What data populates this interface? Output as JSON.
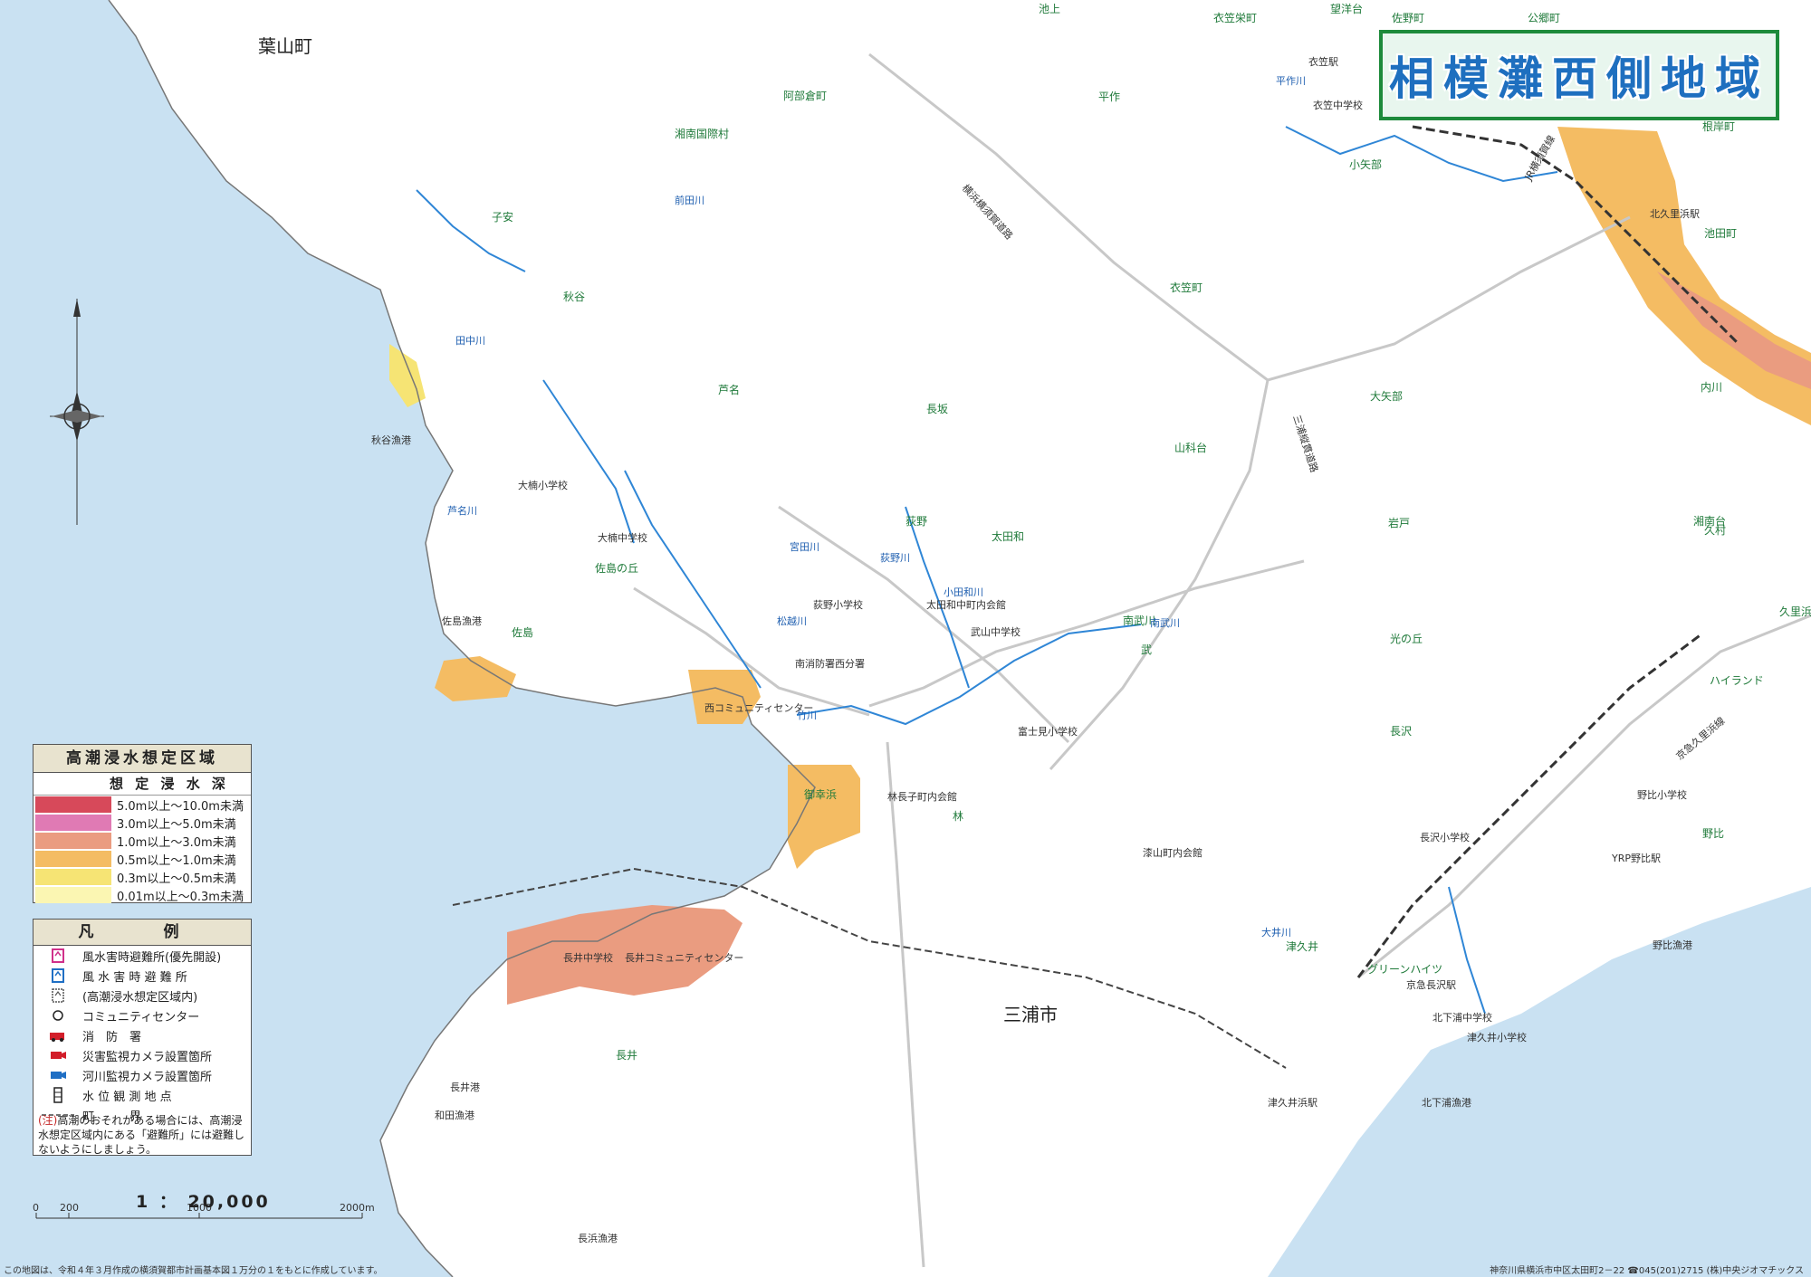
{
  "title": "相模灘西側地域",
  "scale": "1 ： 20,000",
  "scalebar_ticks": [
    "0",
    "200",
    "1000",
    "2000m"
  ],
  "municipalities": [
    "葉山町",
    "三浦市"
  ],
  "stations": [
    "衣笠駅",
    "北久里浜駅",
    "京急長沢駅",
    "津久井浜駅",
    "YRP野比駅"
  ],
  "district_labels": [
    "衣笠栄町",
    "阿部倉町",
    "平作",
    "池上",
    "望洋台",
    "佐野町",
    "公郷町",
    "湘南国際村",
    "子安",
    "秋谷",
    "小矢部",
    "衣笠町",
    "芦名",
    "長坂",
    "大矢部",
    "山科台",
    "佐島の丘",
    "太田和",
    "荻野",
    "佐島",
    "御幸浜",
    "林",
    "武",
    "南武川",
    "光の丘",
    "長沢",
    "野比",
    "津久井",
    "長井",
    "グリーンハイツ",
    "岩戸",
    "久村",
    "ハイランド",
    "池田町",
    "根岸町",
    "内川",
    "湘南台",
    "久里浜"
  ],
  "facility_labels": [
    "南消防署西分署",
    "西コミュニティセンター",
    "長井コミュニティセンター",
    "大楠中学校",
    "武山中学校",
    "衣笠中学校",
    "北下浦中学校",
    "長井中学校",
    "大楠小学校",
    "荻野小学校",
    "富士見小学校",
    "長沢小学校",
    "野比小学校",
    "津久井小学校",
    "太田和中町内会館",
    "林長子町内会館",
    "漆山町内会館",
    "長井港",
    "秋谷漁港",
    "佐島漁港",
    "長浜漁港",
    "和田漁港",
    "北下浦漁港",
    "野比漁港"
  ],
  "rivers": [
    "竹川",
    "前田川",
    "平作川",
    "松越川",
    "宮田川",
    "荻野川",
    "小田和川",
    "南武川",
    "大井川",
    "芦名川",
    "田中川"
  ],
  "roads": [
    "横浜横須賀道路",
    "三浦縦貫道路",
    "京急久里浜線",
    "JR横須賀線"
  ],
  "surge_legend": {
    "title": "高潮浸水想定区域",
    "subtitle": "想 定 浸 水 深",
    "rows": [
      {
        "label": "5.0m以上～10.0m未満",
        "color": "#d7495a"
      },
      {
        "label": "3.0m以上～5.0m未満",
        "color": "#e07ab4"
      },
      {
        "label": "1.0m以上～3.0m未満",
        "color": "#ea9c80"
      },
      {
        "label": "0.5m以上～1.0m未満",
        "color": "#f4bc63"
      },
      {
        "label": "0.3m以上～0.5m未満",
        "color": "#f6e474"
      },
      {
        "label": "0.01m以上～0.3m未満",
        "color": "#fbf6b2"
      }
    ]
  },
  "legend": {
    "title": "凡　例",
    "items": [
      {
        "label": "風水害時避難所(優先開設)",
        "icon": "shelter-priority-icon"
      },
      {
        "label": "風 水 害 時 避 難 所",
        "icon": "shelter-icon"
      },
      {
        "label": "(高潮浸水想定区域内)",
        "icon": "shelter-in-zone-icon"
      },
      {
        "label": "コミュニティセンター",
        "icon": "community-center-icon"
      },
      {
        "label": "消　防　署",
        "icon": "fire-station-icon"
      },
      {
        "label": "災害監視カメラ設置箇所",
        "icon": "disaster-camera-icon"
      },
      {
        "label": "河川監視カメラ設置箇所",
        "icon": "river-camera-icon"
      },
      {
        "label": "水 位 観 測 地 点",
        "icon": "water-gauge-icon"
      },
      {
        "label": "町　　　界",
        "icon": "town-boundary-icon"
      }
    ]
  },
  "note": {
    "prefix": "(注)",
    "text": "高潮のおそれがある場合には、高潮浸水想定区域内にある「避難所」には避難しないようにしましょう。"
  },
  "footer_left": "この地図は、令和４年３月作成の横須賀都市計画基本図１万分の１をもとに作成しています。",
  "footer_right": "神奈川県横浜市中区太田町2－22 ☎045(201)2715 (株)中央ジオマチックス",
  "colors": {
    "sea": "#c9e1f2",
    "land": "#ffffff",
    "road": "#c8c8c8",
    "river": "#2f86d6",
    "title_text": "#1e6fbf",
    "title_border": "#1d8a3b"
  }
}
